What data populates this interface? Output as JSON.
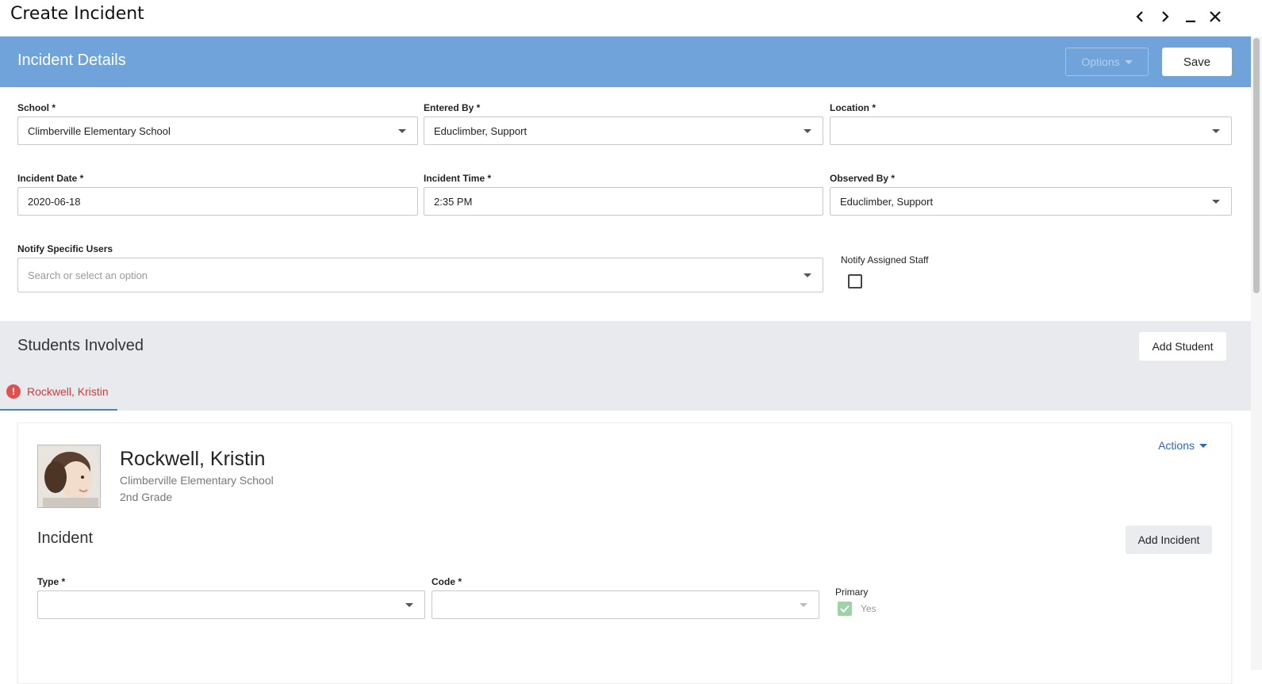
{
  "window": {
    "title": "Create Incident",
    "controls": [
      "prev-icon",
      "next-icon",
      "minimize-icon",
      "close-icon"
    ]
  },
  "header": {
    "title": "Incident Details",
    "options_label": "Options",
    "save_label": "Save"
  },
  "form": {
    "school": {
      "label": "School *",
      "value": "Climberville Elementary School"
    },
    "entered_by": {
      "label": "Entered By *",
      "value": "Educlimber, Support"
    },
    "location": {
      "label": "Location *",
      "value": ""
    },
    "incident_date": {
      "label": "Incident Date *",
      "value": "2020-06-18"
    },
    "incident_time": {
      "label": "Incident Time *",
      "value": "2:35 PM"
    },
    "observed_by": {
      "label": "Observed By *",
      "value": "Educlimber, Support"
    },
    "notify_users": {
      "label": "Notify Specific Users",
      "placeholder": "Search or select an option"
    },
    "notify_staff": {
      "label": "Notify Assigned Staff",
      "checked": false
    }
  },
  "students": {
    "title": "Students Involved",
    "add_label": "Add Student",
    "tabs": [
      {
        "label": "Rockwell, Kristin",
        "error": true
      }
    ]
  },
  "student_card": {
    "name": "Rockwell, Kristin",
    "school": "Climberville Elementary School",
    "grade": "2nd Grade",
    "actions_label": "Actions",
    "incident_title": "Incident",
    "add_incident_label": "Add Incident",
    "type": {
      "label": "Type *",
      "value": ""
    },
    "code": {
      "label": "Code *",
      "value": ""
    },
    "primary": {
      "label": "Primary",
      "value_label": "Yes",
      "checked": true
    }
  },
  "colors": {
    "header_bg": "#6fa3d9",
    "section_bg": "#e8eaee",
    "error": "#d23b3b",
    "link": "#2b66c9"
  }
}
